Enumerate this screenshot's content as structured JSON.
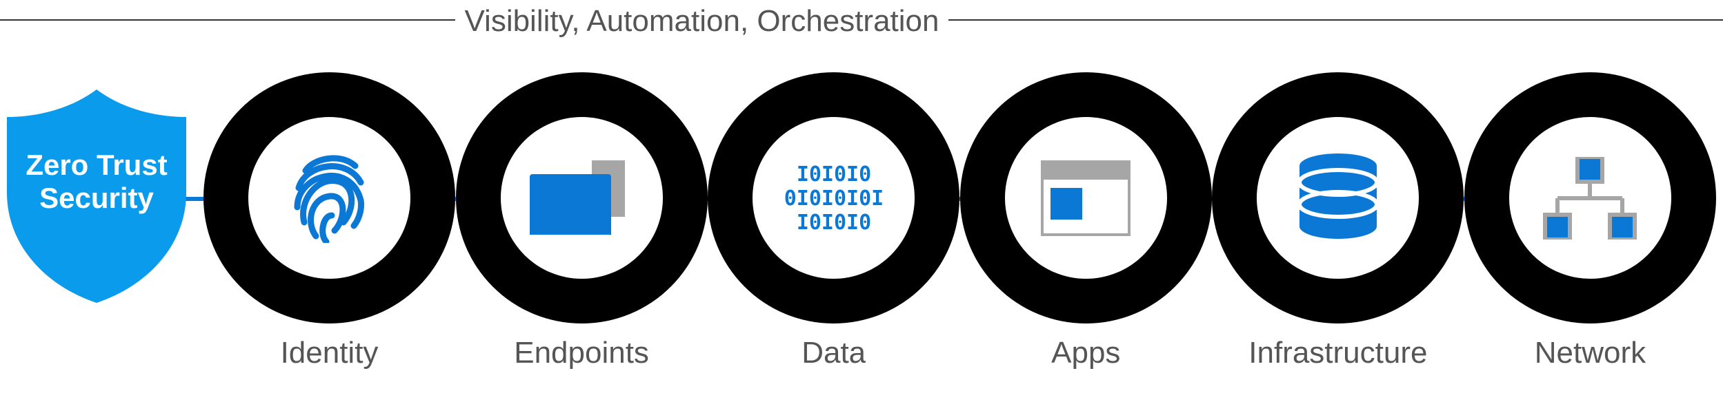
{
  "header": {
    "title": "Visibility, Automation, Orchestration"
  },
  "shield": {
    "line1": "Zero Trust",
    "line2": "Security"
  },
  "pillars": [
    {
      "label": "Identity",
      "icon": "fingerprint-icon"
    },
    {
      "label": "Endpoints",
      "icon": "devices-icon"
    },
    {
      "label": "Data",
      "icon": "binary-data-icon"
    },
    {
      "label": "Apps",
      "icon": "app-window-icon"
    },
    {
      "label": "Infrastructure",
      "icon": "database-icon"
    },
    {
      "label": "Network",
      "icon": "network-icon"
    }
  ],
  "colors": {
    "accent": "#0a78d4",
    "secondary": "#a6a6a6",
    "ring": "#000000",
    "text": "#555555"
  }
}
